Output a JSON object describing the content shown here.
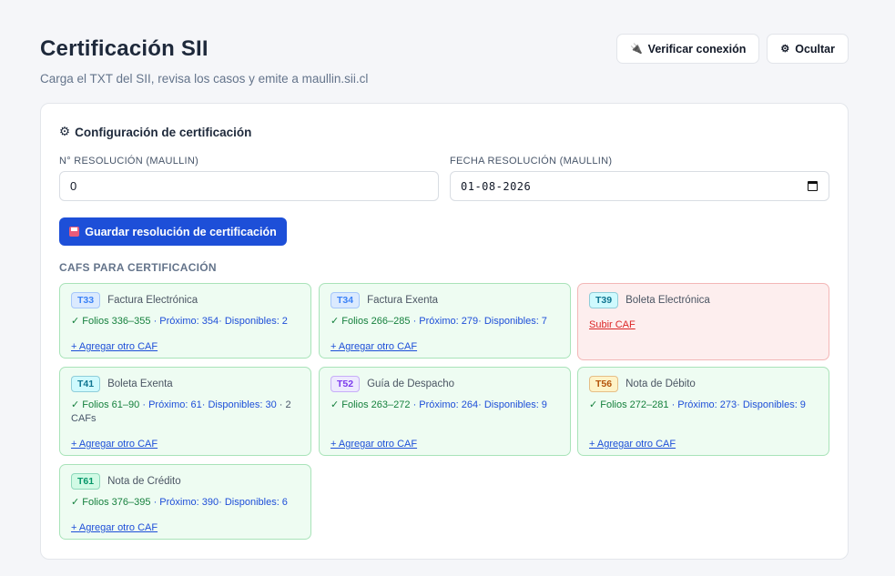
{
  "header": {
    "title": "Certificación SII",
    "subtitle": "Carga el TXT del SII, revisa los casos y emite a maullin.sii.cl",
    "verify_label": "Verificar conexión",
    "hide_label": "Ocultar",
    "verify_icon": "🔌",
    "hide_icon": "⚙"
  },
  "config": {
    "title": "Configuración de certificación",
    "title_icon": "⚙",
    "resolution_number_label": "N° RESOLUCIÓN (MAULLIN)",
    "resolution_number_value": "0",
    "resolution_date_label": "FECHA RESOLUCIÓN (MAULLIN)",
    "resolution_date_value": "01-08-2026",
    "save_label": "Guardar resolución de certificación"
  },
  "cafs": {
    "section_label": "CAFS PARA CERTIFICACIÓN",
    "items": [
      {
        "code": "T33",
        "name": "Factura Electrónica",
        "ok": true,
        "folios": "Folios 336–355",
        "meta": "· Próximo: 354· Disponibles: 2",
        "count": "",
        "link": "+ Agregar otro CAF",
        "badge_color": "#3b82f6",
        "badge_bg": "#dbeafe"
      },
      {
        "code": "T34",
        "name": "Factura Exenta",
        "ok": true,
        "folios": "Folios 266–285",
        "meta": "· Próximo: 279· Disponibles: 7",
        "count": "",
        "link": "+ Agregar otro CAF",
        "badge_color": "#3b82f6",
        "badge_bg": "#dbeafe"
      },
      {
        "code": "T39",
        "name": "Boleta Electrónica",
        "ok": false,
        "folios": "",
        "meta": "",
        "count": "",
        "link": "Subir CAF",
        "badge_color": "#0e7490",
        "badge_bg": "#cffafe"
      },
      {
        "code": "T41",
        "name": "Boleta Exenta",
        "ok": true,
        "folios": "Folios 61–90",
        "meta": "· Próximo: 61· Disponibles: 30",
        "count": "· 2 CAFs",
        "link": "+ Agregar otro CAF",
        "badge_color": "#0e7490",
        "badge_bg": "#cffafe"
      },
      {
        "code": "T52",
        "name": "Guía de Despacho",
        "ok": true,
        "folios": "Folios 263–272",
        "meta": "· Próximo: 264· Disponibles: 9",
        "count": "",
        "link": "+ Agregar otro CAF",
        "badge_color": "#7c3aed",
        "badge_bg": "#ede9fe"
      },
      {
        "code": "T56",
        "name": "Nota de Débito",
        "ok": true,
        "folios": "Folios 272–281",
        "meta": "· Próximo: 273· Disponibles: 9",
        "count": "",
        "link": "+ Agregar otro CAF",
        "badge_color": "#b45309",
        "badge_bg": "#fef3c7"
      },
      {
        "code": "T61",
        "name": "Nota de Crédito",
        "ok": true,
        "folios": "Folios 376–395",
        "meta": "· Próximo: 390· Disponibles: 6",
        "count": "",
        "link": "+ Agregar otro CAF",
        "badge_color": "#059669",
        "badge_bg": "#d1fae5"
      }
    ]
  }
}
